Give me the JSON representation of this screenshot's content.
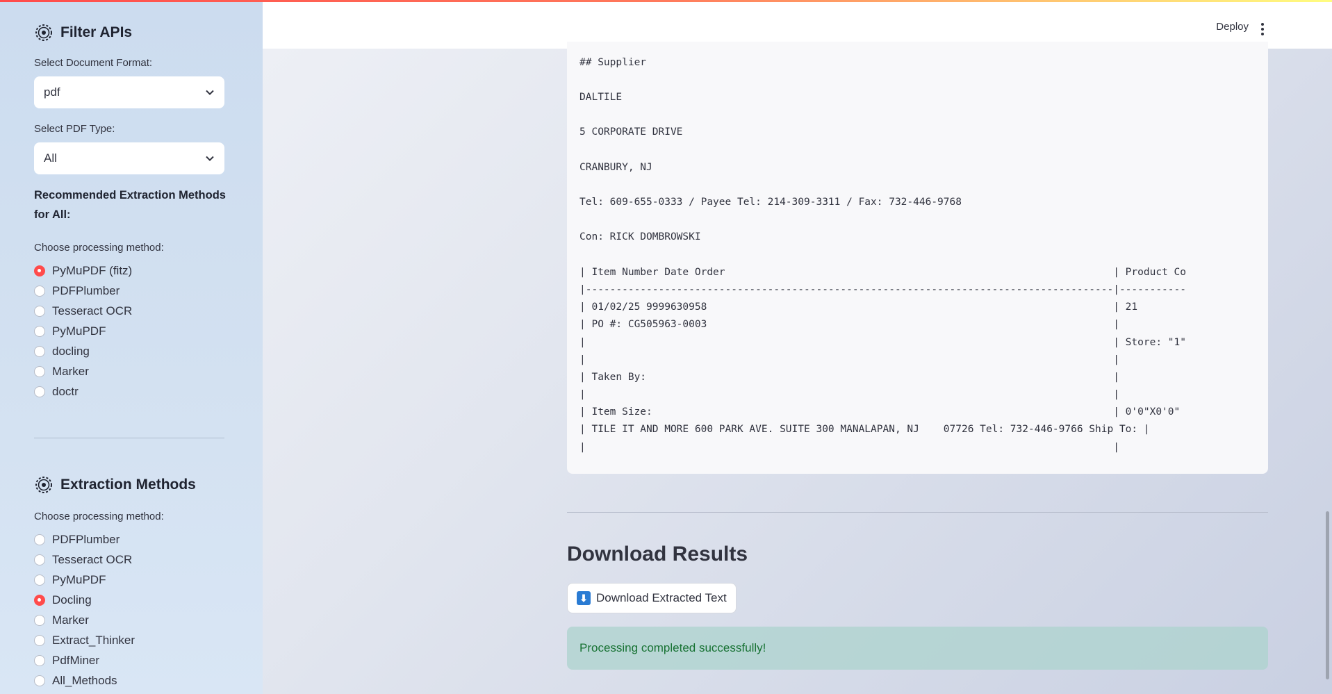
{
  "sidebar": {
    "filter_title": "Filter APIs",
    "format_label": "Select Document Format:",
    "format_value": "pdf",
    "pdf_type_label": "Select PDF Type:",
    "pdf_type_value": "All",
    "recommended_title": "Recommended Extraction Methods for All:",
    "choose_label_1": "Choose processing method:",
    "recommended_methods": [
      {
        "label": "PyMuPDF (fitz)",
        "selected": true
      },
      {
        "label": "PDFPlumber",
        "selected": false
      },
      {
        "label": "Tesseract OCR",
        "selected": false
      },
      {
        "label": "PyMuPDF",
        "selected": false
      },
      {
        "label": "docling",
        "selected": false
      },
      {
        "label": "Marker",
        "selected": false
      },
      {
        "label": "doctr",
        "selected": false
      }
    ],
    "extraction_title": "Extraction Methods",
    "choose_label_2": "Choose processing method:",
    "extraction_methods": [
      {
        "label": "PDFPlumber",
        "selected": false
      },
      {
        "label": "Tesseract OCR",
        "selected": false
      },
      {
        "label": "PyMuPDF",
        "selected": false
      },
      {
        "label": "Docling",
        "selected": true
      },
      {
        "label": "Marker",
        "selected": false
      },
      {
        "label": "Extract_Thinker",
        "selected": false
      },
      {
        "label": "PdfMiner",
        "selected": false
      },
      {
        "label": "All_Methods",
        "selected": false
      }
    ]
  },
  "header": {
    "deploy_label": "Deploy"
  },
  "code_block": {
    "lines": [
      "## Supplier",
      "DALTILE",
      "5 CORPORATE DRIVE",
      "CRANBURY, NJ",
      "Tel: 609-655-0333 / Payee Tel: 214-309-3311 / Fax: 732-446-9768",
      "Con: RICK DOMBROWSKI",
      "| Item Number Date Order                                                                | Product Co",
      "|---------------------------------------------------------------------------------------|-----------",
      "| 01/02/25 9999630958                                                                   | 21",
      "| PO #: CG505963-0003                                                                   |",
      "|                                                                                       | Store: \"1\"",
      "|                                                                                       |",
      "| Taken By:                                                                             |",
      "|                                                                                       |",
      "| Item Size:                                                                            | 0'0\"X0'0\"",
      "| TILE IT AND MORE 600 PARK AVE. SUITE 300 MANALAPAN, NJ    07726 Tel: 732-446-9766 Ship To: |",
      "|                                                                                       |"
    ]
  },
  "download": {
    "heading": "Download Results",
    "button_label": "Download Extracted Text",
    "button_icon": "⬇"
  },
  "status": {
    "message": "Processing completed successfully!"
  },
  "colors": {
    "accent": "#ff4b4b",
    "success_text": "#177233",
    "success_bg": "#b9d9d4"
  }
}
